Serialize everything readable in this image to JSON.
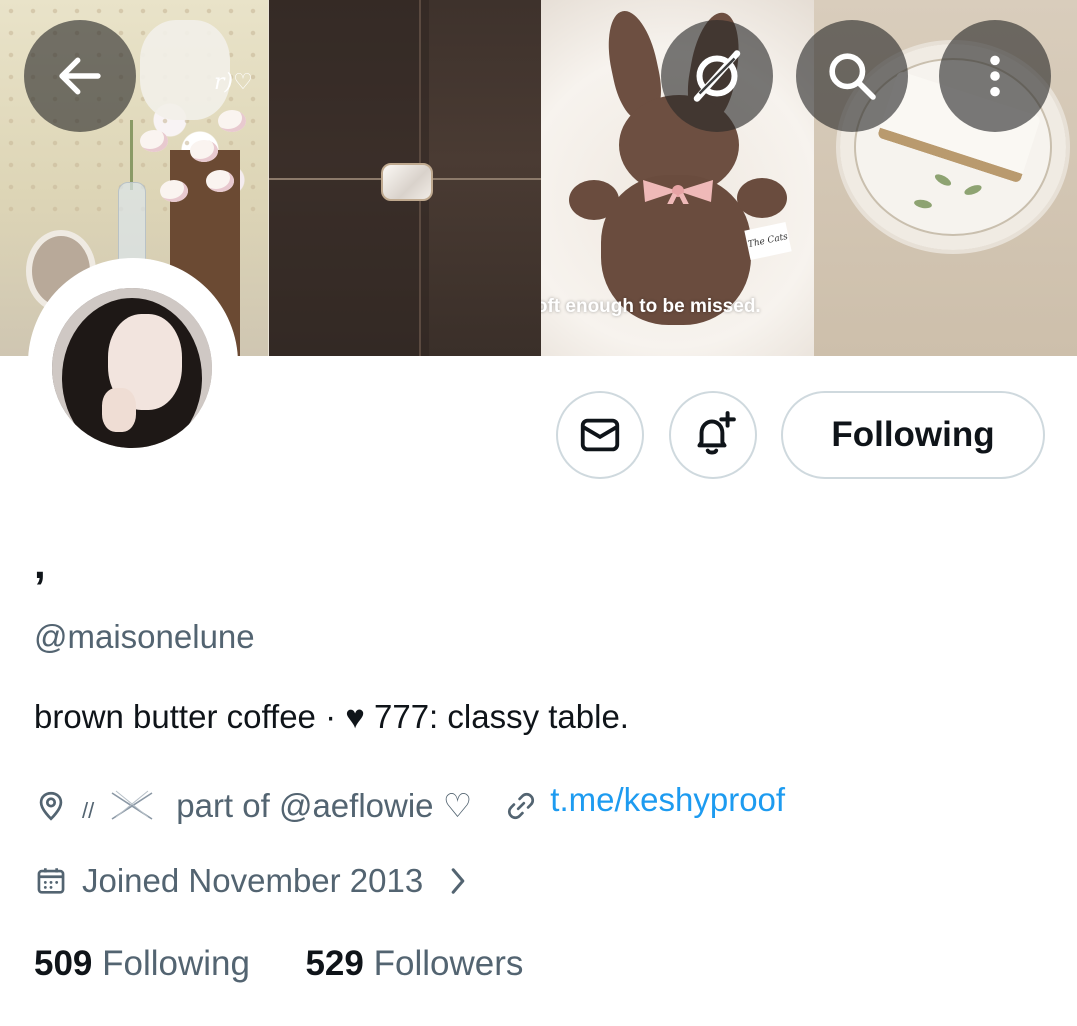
{
  "banner": {
    "caption": "soft enough to be missed.",
    "tag_text": "The Cats",
    "tile1_text": "r)♡"
  },
  "top_bar": {
    "back_icon": "arrow-left-icon",
    "grok_icon": "grok-icon",
    "search_icon": "search-icon",
    "more_icon": "more-vertical-icon"
  },
  "actions": {
    "message_icon": "mail-icon",
    "notify_icon": "bell-plus-icon",
    "following_label": "Following"
  },
  "profile": {
    "display_name": ",",
    "handle": "@maisonelune",
    "bio": "brown butter coffee · ♥ 777: classy table.",
    "location_sep": "//",
    "location_text": "part  of  @aeflowie  ♡",
    "website": "t.me/keshyproof",
    "joined": "Joined November 2013",
    "following_count": "509",
    "following_label": "Following",
    "followers_count": "529",
    "followers_label": "Followers"
  },
  "colors": {
    "text_primary": "#0f1419",
    "text_secondary": "#536471",
    "link": "#1d9bf0",
    "border": "#cfd9de"
  }
}
